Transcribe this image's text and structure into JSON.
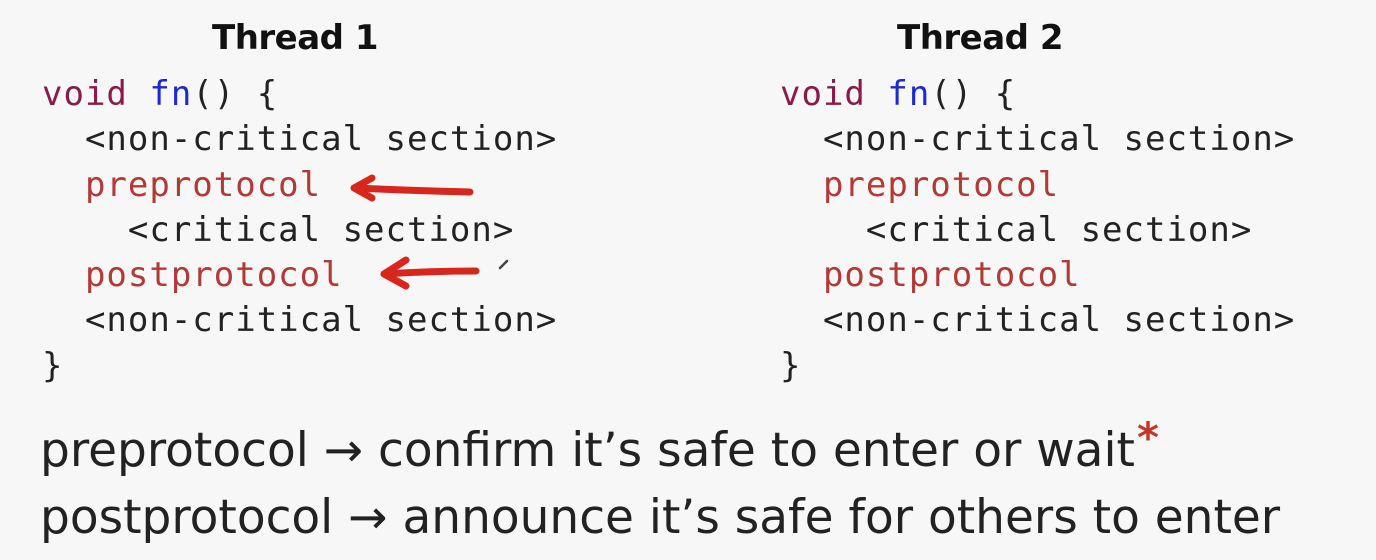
{
  "columns": [
    {
      "title": "Thread 1",
      "code": {
        "kw": "void",
        "fn": "fn",
        "sig_rest": "() {",
        "line2": "  <non-critical section>",
        "line3": "  preprotocol",
        "line4": "    <critical section>",
        "line5": "  postprotocol",
        "line6": "  <non-critical section>",
        "line7": "}"
      }
    },
    {
      "title": "Thread 2",
      "code": {
        "kw": "void",
        "fn": "fn",
        "sig_rest": "() {",
        "line2": "  <non-critical section>",
        "line3": "  preprotocol",
        "line4": "    <critical section>",
        "line5": "  postprotocol",
        "line6": "  <non-critical section>",
        "line7": "}"
      }
    }
  ],
  "explanations": [
    {
      "text": "preprotocol → confirm it’s safe to enter or wait",
      "marker": "*"
    },
    {
      "text": "postprotocol → announce it’s safe for others to enter"
    }
  ],
  "colors": {
    "keyword": "#8b1a4b",
    "function": "#1a2ad0",
    "protocol": "#b23a35",
    "annotation": "#d9261c",
    "asterisk": "#c0392b"
  }
}
